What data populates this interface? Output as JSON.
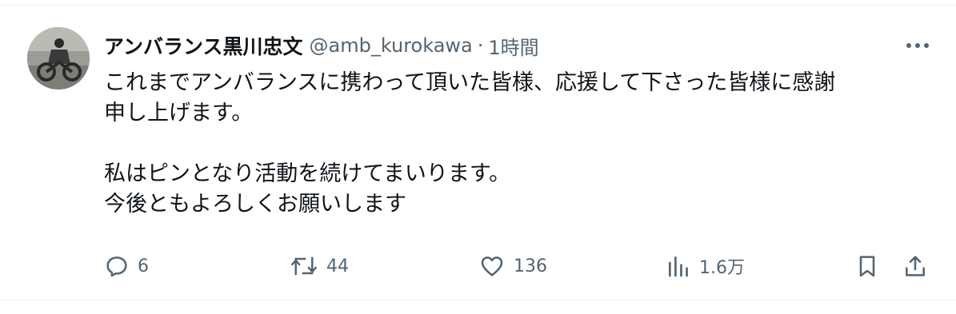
{
  "tweet": {
    "author_name": "アンバランス黒川忠文",
    "handle": "@amb_kurokawa",
    "separator": "·",
    "time": "1時間",
    "lines": [
      "これまでアンバランスに携わって頂いた皆様、応援して下さった皆様に感謝",
      "申し上げます。",
      "",
      "私はピンとなり活動を続けてまいります。",
      "今後ともよろしくお願いします"
    ]
  },
  "actions": {
    "reply_count": "6",
    "retweet_count": "44",
    "like_count": "136",
    "view_count": "1.6万"
  },
  "icons": {
    "more": "more-horizontal-icon",
    "reply": "reply-icon",
    "retweet": "retweet-icon",
    "like": "heart-icon",
    "views": "views-icon",
    "bookmark": "bookmark-icon",
    "share": "share-icon"
  },
  "colors": {
    "text_primary": "#0f1419",
    "text_secondary": "#536471",
    "border": "#eff3f4"
  }
}
